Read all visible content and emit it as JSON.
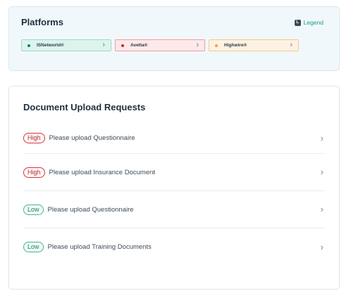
{
  "platforms": {
    "title": "Platforms",
    "legend": "Legend",
    "legend_icon": "L",
    "items": [
      {
        "name": "ISNetworld®",
        "color": "#16805f"
      },
      {
        "name": "Avetta®",
        "color": "#d51f2c"
      },
      {
        "name": "Highwire®",
        "color": "#f0a23a"
      }
    ]
  },
  "documents": {
    "title": "Document Upload Requests",
    "requests": [
      {
        "priority": "High",
        "text": "Please upload Questionnaire"
      },
      {
        "priority": "High",
        "text": "Please upload Insurance Document"
      },
      {
        "priority": "Low",
        "text": "Please upload Questionnaire"
      },
      {
        "priority": "Low",
        "text": "Please upload Training Documents"
      }
    ]
  }
}
